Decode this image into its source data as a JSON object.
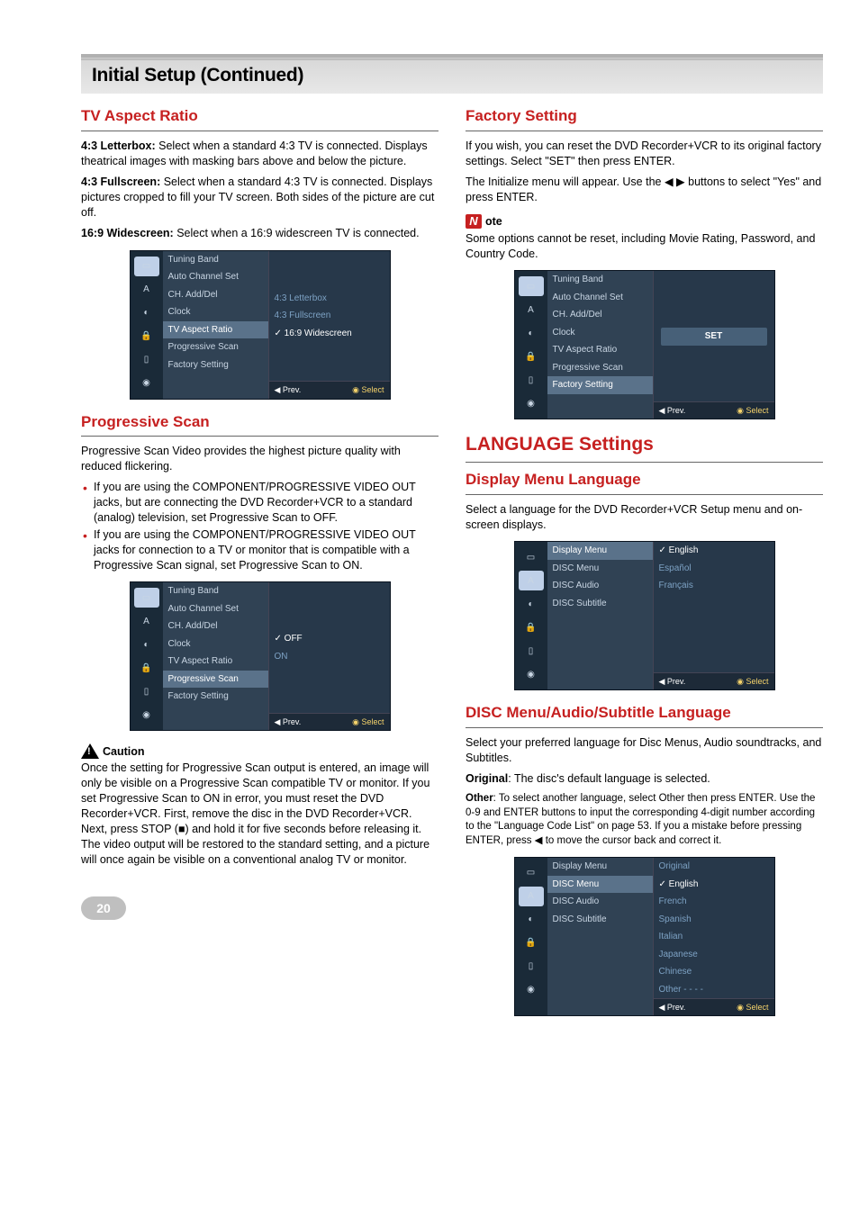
{
  "page_title": "Initial Setup (Continued)",
  "left": {
    "tv_aspect": {
      "heading": "TV Aspect Ratio",
      "p1_bold": "4:3 Letterbox:",
      "p1_rest": " Select when a standard 4:3 TV is connected. Displays theatrical images with masking bars above and below the picture.",
      "p2_bold": "4:3 Fullscreen:",
      "p2_rest": " Select when a standard 4:3 TV is connected. Displays pictures cropped to fill your TV screen. Both sides of the picture are cut off.",
      "p3_bold": "16:9 Widescreen:",
      "p3_rest": " Select when a 16:9 widescreen TV is connected."
    },
    "prog_scan": {
      "heading": "Progressive Scan",
      "intro": "Progressive Scan Video provides the highest picture quality with reduced flickering.",
      "b1": "If you are using the COMPONENT/PROGRESSIVE VIDEO OUT jacks, but are connecting the DVD Recorder+VCR to a standard (analog) television, set Progressive Scan to OFF.",
      "b2": "If you are using the COMPONENT/PROGRESSIVE VIDEO OUT jacks for connection to a TV or monitor that is compatible with a Progressive Scan signal, set Progressive Scan to ON.",
      "caution_label": "Caution",
      "caution_text": "Once the setting for Progressive Scan output is entered, an image will only be visible on a Progressive Scan compatible TV or monitor. If you set Progressive Scan to ON in error, you must reset the DVD Recorder+VCR. First, remove the disc in the DVD Recorder+VCR. Next, press STOP (■) and hold it for five seconds before releasing it. The video output will be restored to the standard setting, and a picture will once again be visible on a conventional analog TV or monitor."
    }
  },
  "right": {
    "factory": {
      "heading": "Factory Setting",
      "p1": "If you wish, you can reset the DVD Recorder+VCR to its original factory settings. Select \"SET\" then press ENTER.",
      "p2": "The Initialize menu will appear. Use the ◀ ▶ buttons to select \"Yes\" and press ENTER.",
      "note_label": "ote",
      "note_text": "Some options cannot be reset, including Movie Rating, Password, and Country Code."
    },
    "lang_major": "LANGUAGE Settings",
    "display_menu": {
      "heading": "Display Menu Language",
      "p": "Select a language for the DVD Recorder+VCR Setup menu and on-screen displays."
    },
    "disc_menu": {
      "heading": "DISC Menu/Audio/Subtitle Language",
      "p1": "Select your preferred language for Disc Menus, Audio soundtracks, and Subtitles.",
      "orig_bold": "Original",
      "orig_rest": ": The disc's default language is selected.",
      "other_bold": "Other",
      "other_rest": ": To select another language, select Other then press ENTER. Use the 0-9 and ENTER buttons to input the corresponding 4-digit number according to the \"Language Code List\" on page 53. If you a mistake before pressing ENTER, press ◀ to move the cursor back and correct it."
    }
  },
  "osd_general": {
    "items": [
      "Tuning Band",
      "Auto Channel Set",
      "CH. Add/Del",
      "Clock",
      "TV Aspect Ratio",
      "Progressive Scan",
      "Factory Setting"
    ],
    "prev": "Prev.",
    "select": "Select"
  },
  "osd1_values": [
    "4:3 Letterbox",
    "4:3 Fullscreen",
    "16:9 Widescreen"
  ],
  "osd1_selected_value": "16:9 Widescreen",
  "osd1_highlight": "TV Aspect Ratio",
  "osd2_values": [
    "OFF",
    "ON"
  ],
  "osd2_selected_value": "OFF",
  "osd2_highlight": "Progressive Scan",
  "osd3_highlight": "Factory Setting",
  "osd3_button": "SET",
  "osd_lang": {
    "items": [
      "Display Menu",
      "DISC Menu",
      "DISC Audio",
      "DISC Subtitle"
    ]
  },
  "osd4_highlight": "Display Menu",
  "osd4_values": [
    "English",
    "Español",
    "Français"
  ],
  "osd4_selected_value": "English",
  "osd5_highlight": "DISC Menu",
  "osd5_topvalue": "Original",
  "osd5_values": [
    "English",
    "French",
    "Spanish",
    "Italian",
    "Japanese",
    "Chinese",
    "Other    - - - -"
  ],
  "osd5_selected_value": "English",
  "page_number": "20"
}
